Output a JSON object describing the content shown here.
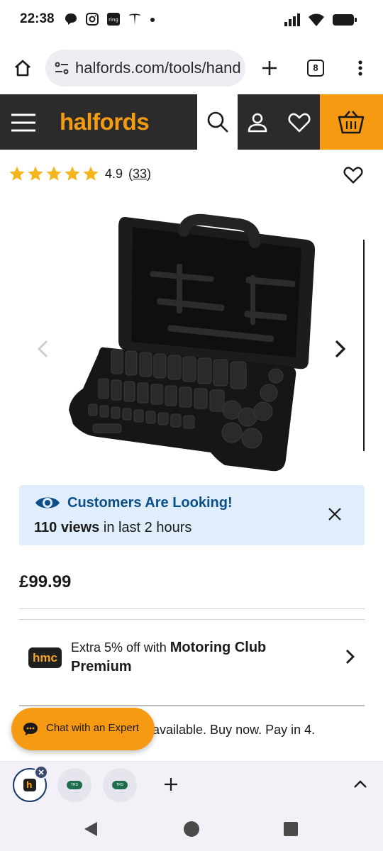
{
  "status_bar": {
    "time": "22:38",
    "icons_left": [
      "chat-bubble-icon",
      "instagram-icon",
      "ring-icon",
      "tesla-icon",
      "dot-icon"
    ],
    "icons_right": [
      "signal-icon",
      "wifi-icon",
      "battery-icon"
    ]
  },
  "browser": {
    "url": "halfords.com/tools/hand",
    "tab_count": "8"
  },
  "site_header": {
    "logo": "halfords",
    "accent": "#f59a12"
  },
  "product": {
    "rating": "4.9",
    "rating_count": "(33)",
    "stars": 5,
    "price": "£99.99"
  },
  "looking": {
    "title": "Customers Are Looking!",
    "views_bold": "110 views",
    "views_rest": " in last 2 hours"
  },
  "hmc": {
    "badge": "hmc",
    "text": "Extra 5% off with ",
    "bold": "Motoring Club Premium"
  },
  "klarna": {
    "text": "available. Buy now. Pay in 4."
  },
  "chat": {
    "label": "Chat with an Expert"
  },
  "tab_strip": {
    "thumb_2": "TRS",
    "thumb_3": "TRS"
  }
}
